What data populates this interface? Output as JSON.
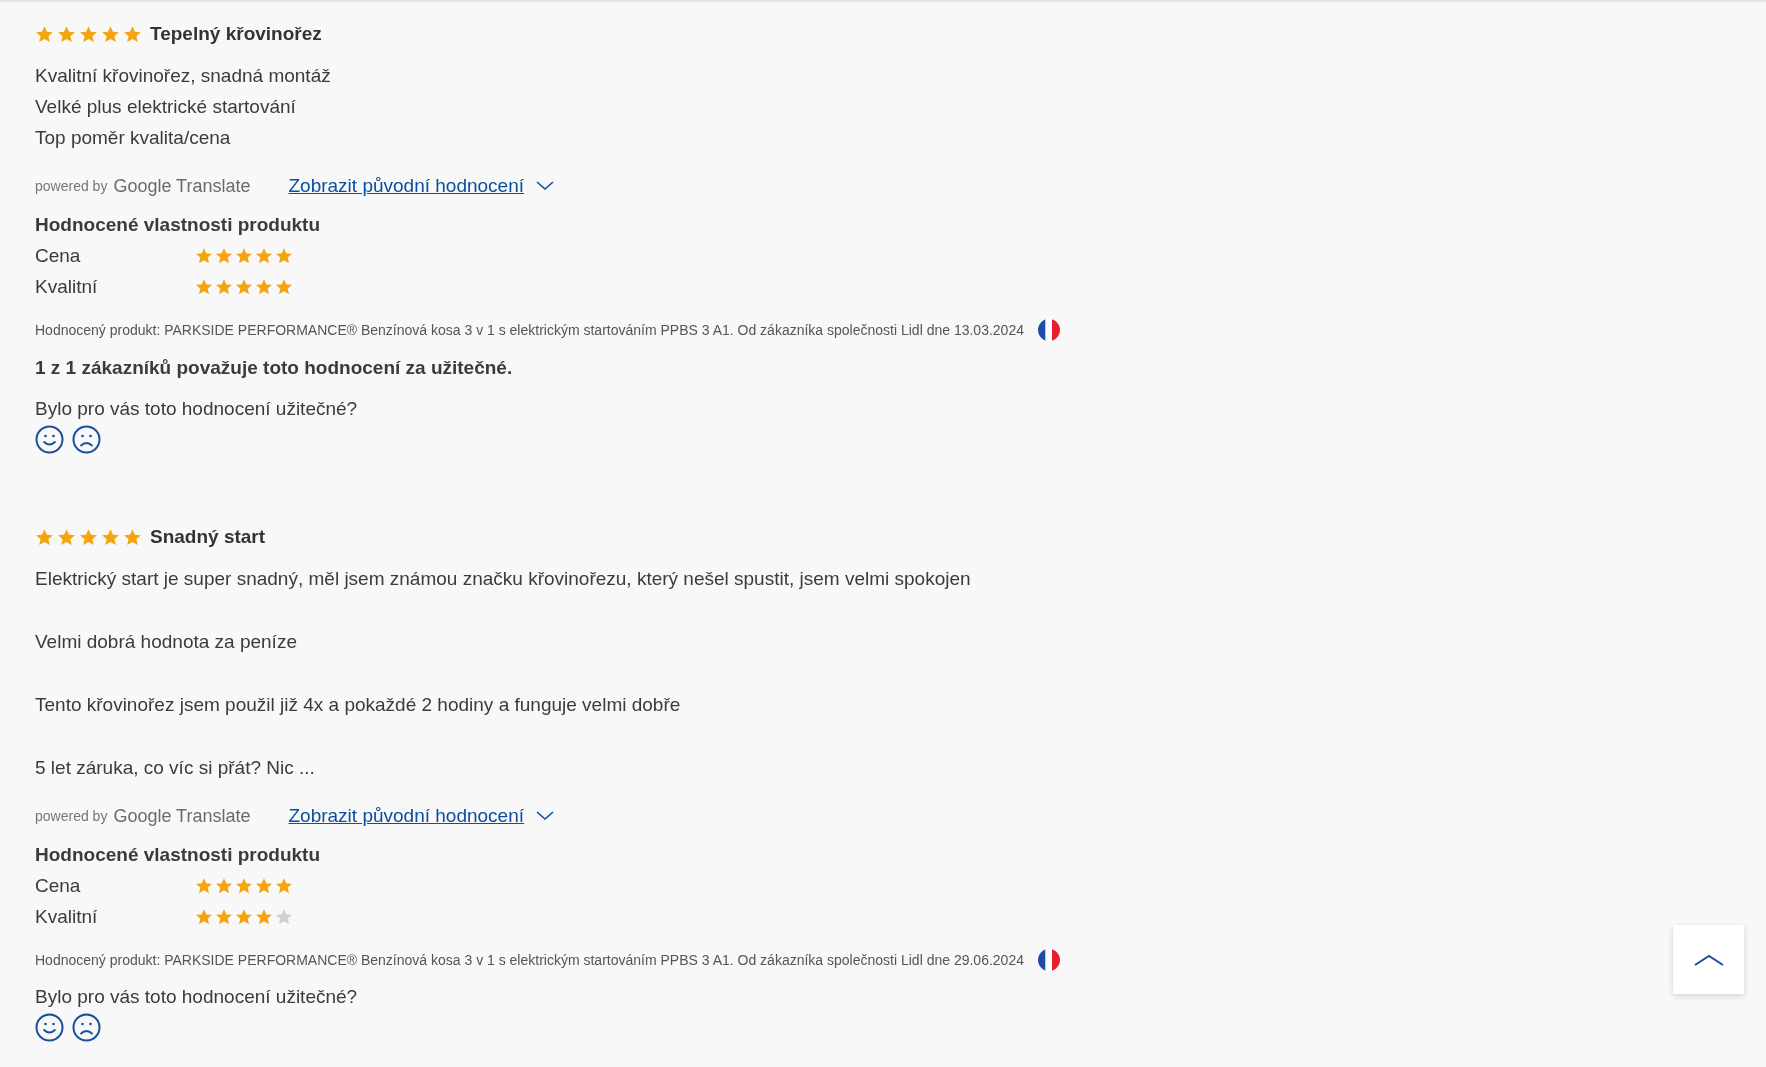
{
  "reviews": [
    {
      "stars": 5,
      "title": "Tepelný křovinořez",
      "kind": "lines",
      "body": [
        "Kvalitní křovinořez, snadná montáž",
        "Velké plus elektrické startování",
        "Top poměr kvalita/cena"
      ],
      "translation": {
        "powered_by": "powered by",
        "brand": "Google Translate",
        "link": "Zobrazit původní hodnocení",
        "expanded": false
      },
      "attributes_heading": "Hodnocené vlastnosti produktu",
      "attributes": [
        {
          "label": "Cena",
          "stars": 5
        },
        {
          "label": "Kvalitní",
          "stars": 5
        }
      ],
      "product_info": "Hodnocený produkt: PARKSIDE PERFORMANCE® Benzínová kosa 3 v 1 s elektrickým startováním PPBS 3 A1. Od zákazníka společnosti Lidl dne 13.03.2024",
      "helpful_count": "1 z 1 zákazníků považuje toto hodnocení za užitečné.",
      "question": "Bylo pro vás toto hodnocení užitečné?"
    },
    {
      "stars": 5,
      "title": "Snadný start",
      "kind": "paragraphs",
      "body": [
        "Elektrický start je super snadný, měl jsem známou značku křovinořezu, který nešel spustit, jsem velmi spokojen",
        "Velmi dobrá hodnota za peníze",
        "Tento křovinořez jsem použil již 4x a pokaždé 2 hodiny a funguje velmi dobře",
        "5 let záruka, co víc si přát? Nic ..."
      ],
      "translation": {
        "powered_by": "powered by",
        "brand": "Google Translate",
        "link": "Zobrazit původní hodnocení",
        "expanded": false
      },
      "attributes_heading": "Hodnocené vlastnosti produktu",
      "attributes": [
        {
          "label": "Cena",
          "stars": 5
        },
        {
          "label": "Kvalitní",
          "stars": 4
        }
      ],
      "product_info": "Hodnocený produkt: PARKSIDE PERFORMANCE® Benzínová kosa 3 v 1 s elektrickým startováním PPBS 3 A1. Od zákazníka společnosti Lidl dne 29.06.2024",
      "question": "Bylo pro vás toto hodnocení užitečné?"
    }
  ]
}
